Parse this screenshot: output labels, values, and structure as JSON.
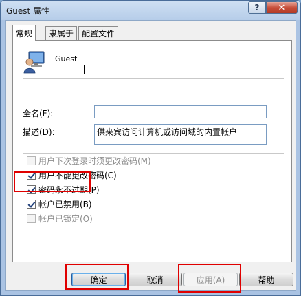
{
  "window": {
    "title": "Guest 属性",
    "help_label": "?",
    "close_label": "✕"
  },
  "tabs": [
    {
      "label": "常规",
      "active": true
    },
    {
      "label": "隶属于",
      "active": false
    },
    {
      "label": "配置文件",
      "active": false
    }
  ],
  "user": {
    "name": "Guest",
    "icon": "user-account-icon"
  },
  "fields": {
    "fullname_label": "全名(F):",
    "fullname_value": "",
    "description_label": "描述(D):",
    "description_value": "供来宾访问计算机或访问域的内置帐户"
  },
  "options": [
    {
      "label": "用户下次登录时须更改密码(M)",
      "checked": false,
      "enabled": false
    },
    {
      "label": "用户不能更改密码(C)",
      "checked": true,
      "enabled": true
    },
    {
      "label": "密码永不过期(P)",
      "checked": true,
      "enabled": true
    },
    {
      "label": "帐户已禁用(B)",
      "checked": true,
      "enabled": true
    },
    {
      "label": "帐户已锁定(O)",
      "checked": false,
      "enabled": false
    }
  ],
  "buttons": {
    "ok": "确定",
    "cancel": "取消",
    "apply": "应用(A)",
    "help": "帮助"
  },
  "colors": {
    "highlight": "#e00000",
    "titlebar": "#b6cde9",
    "close_button": "#c74e3a"
  }
}
